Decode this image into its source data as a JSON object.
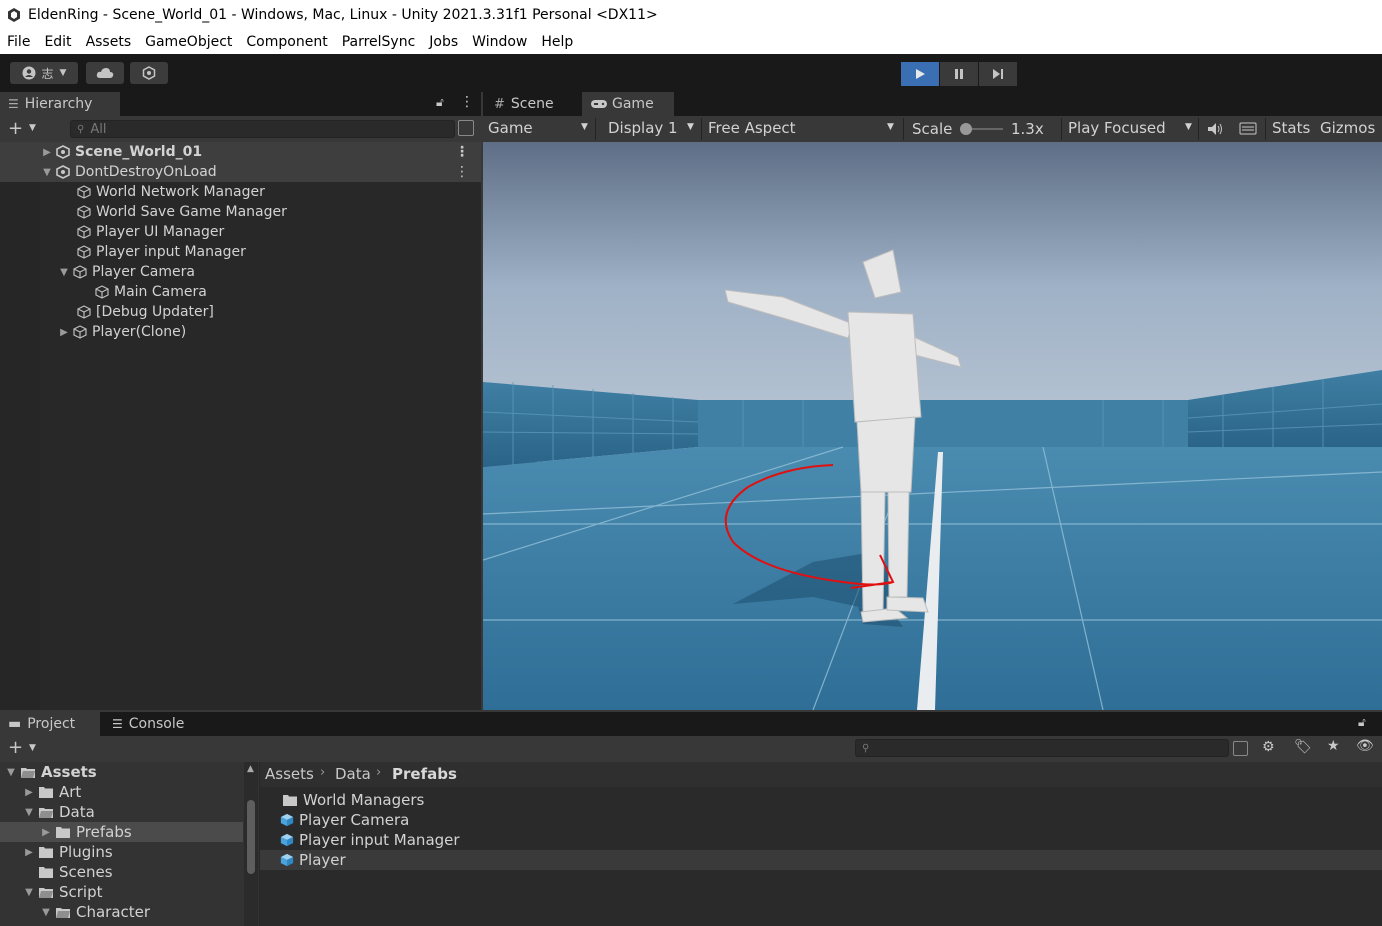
{
  "window": {
    "title": "EldenRing - Scene_World_01 - Windows, Mac, Linux - Unity 2021.3.31f1 Personal <DX11>"
  },
  "menu": [
    "File",
    "Edit",
    "Assets",
    "GameObject",
    "Component",
    "ParrelSync",
    "Jobs",
    "Window",
    "Help"
  ],
  "toolbar": {
    "account_glyph": "志"
  },
  "hierarchy": {
    "tab": "Hierarchy",
    "search_placeholder": "All",
    "rows": [
      {
        "label": "Scene_World_01"
      },
      {
        "label": "DontDestroyOnLoad"
      },
      {
        "label": "World Network Manager"
      },
      {
        "label": "World Save Game Manager"
      },
      {
        "label": "Player UI Manager"
      },
      {
        "label": "Player input Manager"
      },
      {
        "label": "Player Camera"
      },
      {
        "label": "Main Camera"
      },
      {
        "label": "[Debug Updater]"
      },
      {
        "label": "Player(Clone)"
      }
    ]
  },
  "game": {
    "tabs": [
      "Scene",
      "Game"
    ],
    "view_select": "Game",
    "display_select": "Display 1",
    "aspect_select": "Free Aspect",
    "scale_label": "Scale",
    "scale_value": "1.3x",
    "play_mode_select": "Play Focused",
    "stats": "Stats",
    "gizmos": "Gizmos"
  },
  "project": {
    "tabs": [
      "Project",
      "Console"
    ],
    "tree": [
      {
        "label": "Assets"
      },
      {
        "label": "Art"
      },
      {
        "label": "Data"
      },
      {
        "label": "Prefabs"
      },
      {
        "label": "Plugins"
      },
      {
        "label": "Scenes"
      },
      {
        "label": "Script"
      },
      {
        "label": "Character"
      }
    ],
    "breadcrumb": [
      "Assets",
      "Data",
      "Prefabs"
    ],
    "items": [
      {
        "label": "World Managers"
      },
      {
        "label": "Player Camera"
      },
      {
        "label": "Player input Manager"
      },
      {
        "label": "Player"
      }
    ]
  },
  "colors": {
    "play_active": "#3a6fb3",
    "selection": "#3e3e3e",
    "annotation": "#e01010"
  }
}
